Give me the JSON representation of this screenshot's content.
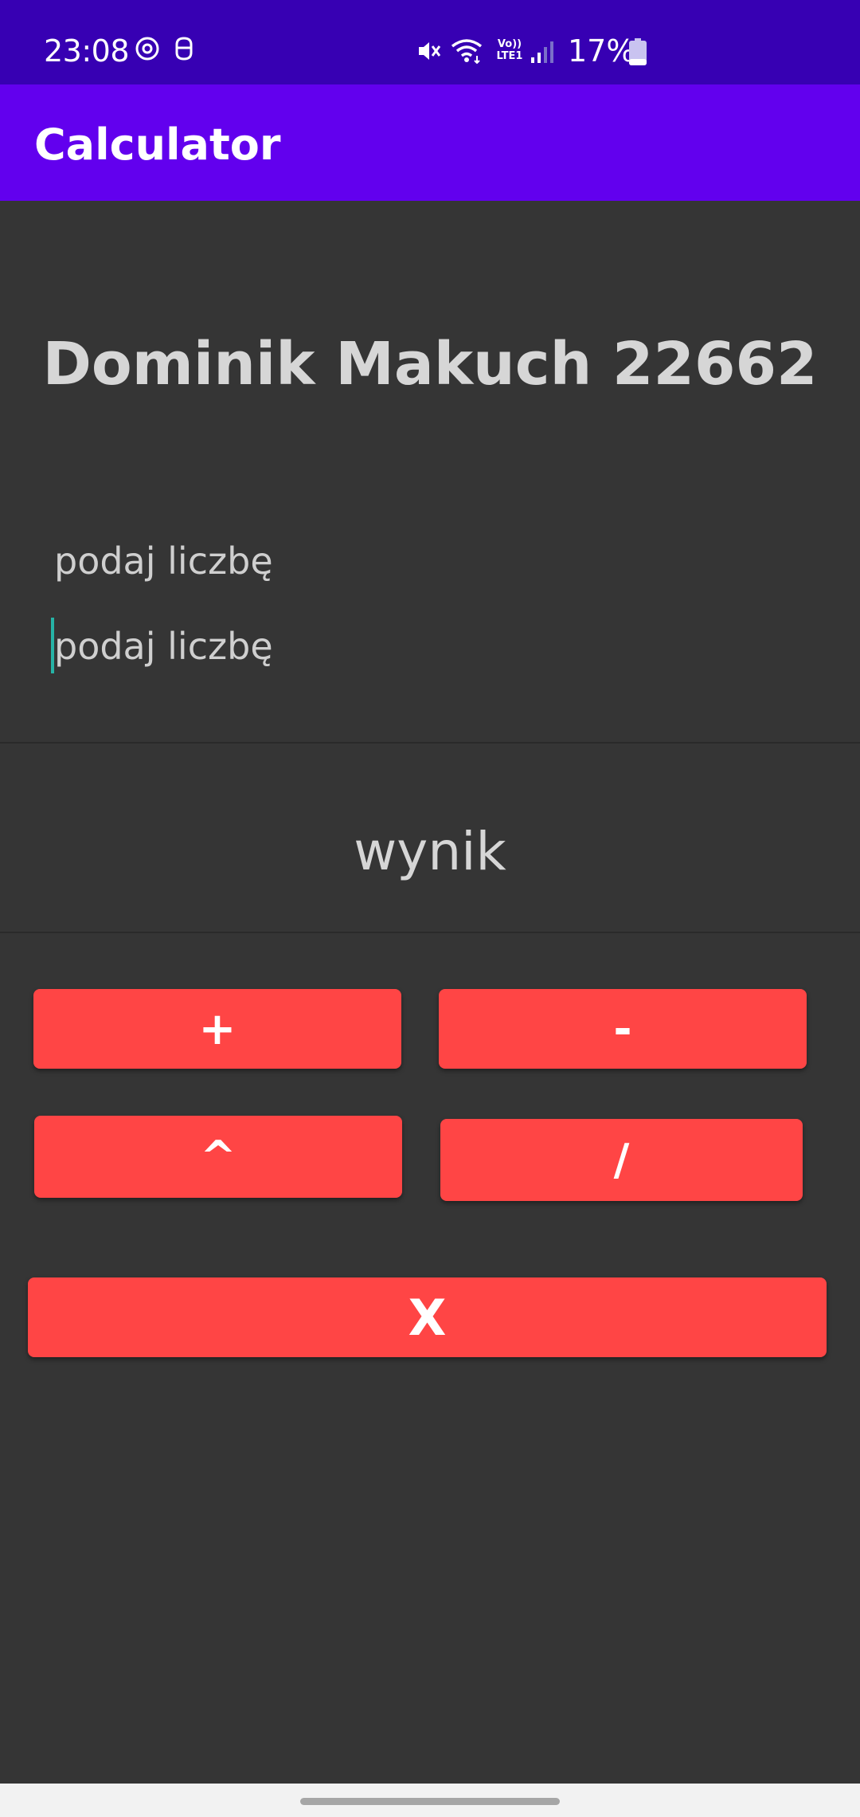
{
  "status_bar": {
    "time": "23:08",
    "battery_percent": "17%",
    "battery_level": 0.17,
    "icons": [
      "notification-icon",
      "smart-icon",
      "mute-icon",
      "wifi-icon",
      "volte-icon",
      "signal-icon",
      "battery-icon"
    ],
    "volte_text_top": "Vo))",
    "volte_text_bottom": "LTE1",
    "background": "#3700b3"
  },
  "app_bar": {
    "title": "Calculator",
    "background": "#6200ee"
  },
  "main": {
    "heading": "Dominik Makuch 22662",
    "input_1": {
      "value": "",
      "placeholder": "podaj liczbę"
    },
    "input_2": {
      "value": "",
      "placeholder": "podaj liczbę"
    },
    "result": "wynik",
    "background": "#353535"
  },
  "buttons": {
    "add": "+",
    "subtract": "-",
    "power": "^",
    "divide": "/",
    "multiply": "X",
    "color": "#ff4545"
  }
}
